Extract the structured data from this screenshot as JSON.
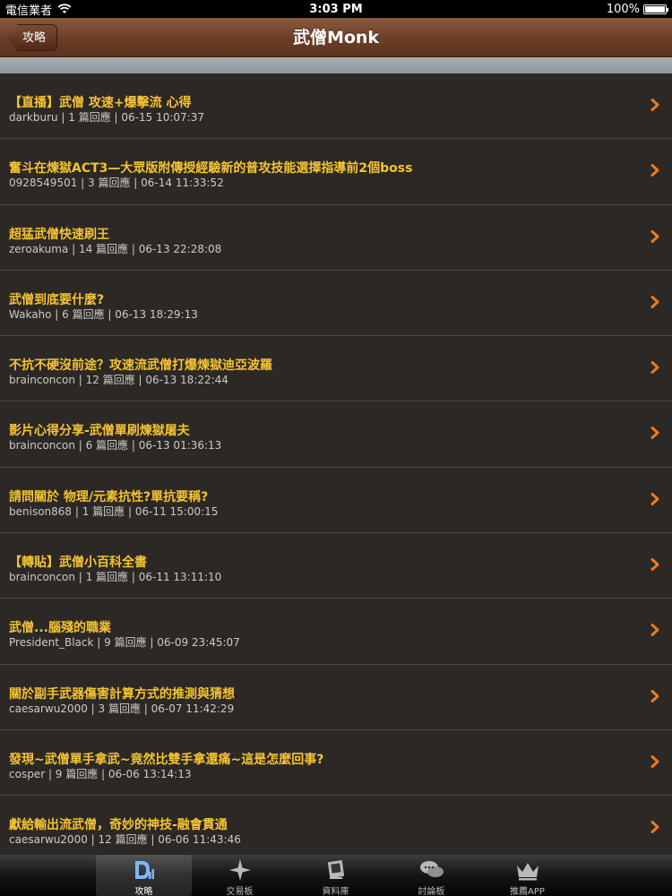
{
  "status": {
    "carrier": "電信業者",
    "time": "3:03 PM",
    "battery": "100%",
    "battery_level": 1.0
  },
  "nav": {
    "back_label": "攻略",
    "title": "武僧Monk"
  },
  "posts": [
    {
      "title": "【直播】武僧 攻速+爆擊流 心得",
      "meta": "darkburu | 1 篇回應 | 06-15 10:07:37"
    },
    {
      "title": "奮斗在煉獄ACT3—大眾版附傳授經驗新的普攻技能選擇指導前2個boss",
      "meta": "0928549501 | 3 篇回應 | 06-14 11:33:52"
    },
    {
      "title": "超猛武僧快速刷王",
      "meta": "zeroakuma | 14 篇回應 | 06-13 22:28:08"
    },
    {
      "title": "武僧到底要什麼?",
      "meta": "Wakaho | 6 篇回應 | 06-13 18:29:13"
    },
    {
      "title": "不抗不硬沒前途？攻速流武僧打爆煉獄迪亞波羅",
      "meta": "brainconcon | 12 篇回應 | 06-13 18:22:44"
    },
    {
      "title": "影片心得分享-武僧單刷煉獄屠夫",
      "meta": "brainconcon | 6 篇回應 | 06-13 01:36:13"
    },
    {
      "title": "請問關於 物理/元素抗性?單抗要稱?",
      "meta": "benison868 | 1 篇回應 | 06-11 15:00:15"
    },
    {
      "title": "【轉貼】武僧小百科全書",
      "meta": "brainconcon | 1 篇回應 | 06-11 13:11:10"
    },
    {
      "title": "武僧...腦殘的職業",
      "meta": "President_Black | 9 篇回應 | 06-09 23:45:07"
    },
    {
      "title": "關於副手武器傷害計算方式的推測與猜想",
      "meta": "caesarwu2000 | 3 篇回應 | 06-07 11:42:29"
    },
    {
      "title": "發現~武僧單手拿武~竟然比雙手拿還痛~這是怎麼回事?",
      "meta": "cosper | 9 篇回應 | 06-06 13:14:13"
    },
    {
      "title": "獻給輸出流武僧，奇妙的神技-融會貫通",
      "meta": "caesarwu2000 | 12 篇回應 | 06-06 11:43:46"
    }
  ],
  "tabs": [
    {
      "label": "攻略",
      "icon": "guide-icon",
      "active": true
    },
    {
      "label": "交易板",
      "icon": "trade-icon",
      "active": false
    },
    {
      "label": "資料庫",
      "icon": "database-icon",
      "active": false
    },
    {
      "label": "討論板",
      "icon": "discussion-icon",
      "active": false
    },
    {
      "label": "推薦APP",
      "icon": "crown-icon",
      "active": false
    }
  ],
  "colors": {
    "title_text": "#f5c332",
    "meta_text": "#cfcac6",
    "row_bg": "#2b2826",
    "chevron": "#f07a1e",
    "nav_brown": "#6b3f27"
  }
}
